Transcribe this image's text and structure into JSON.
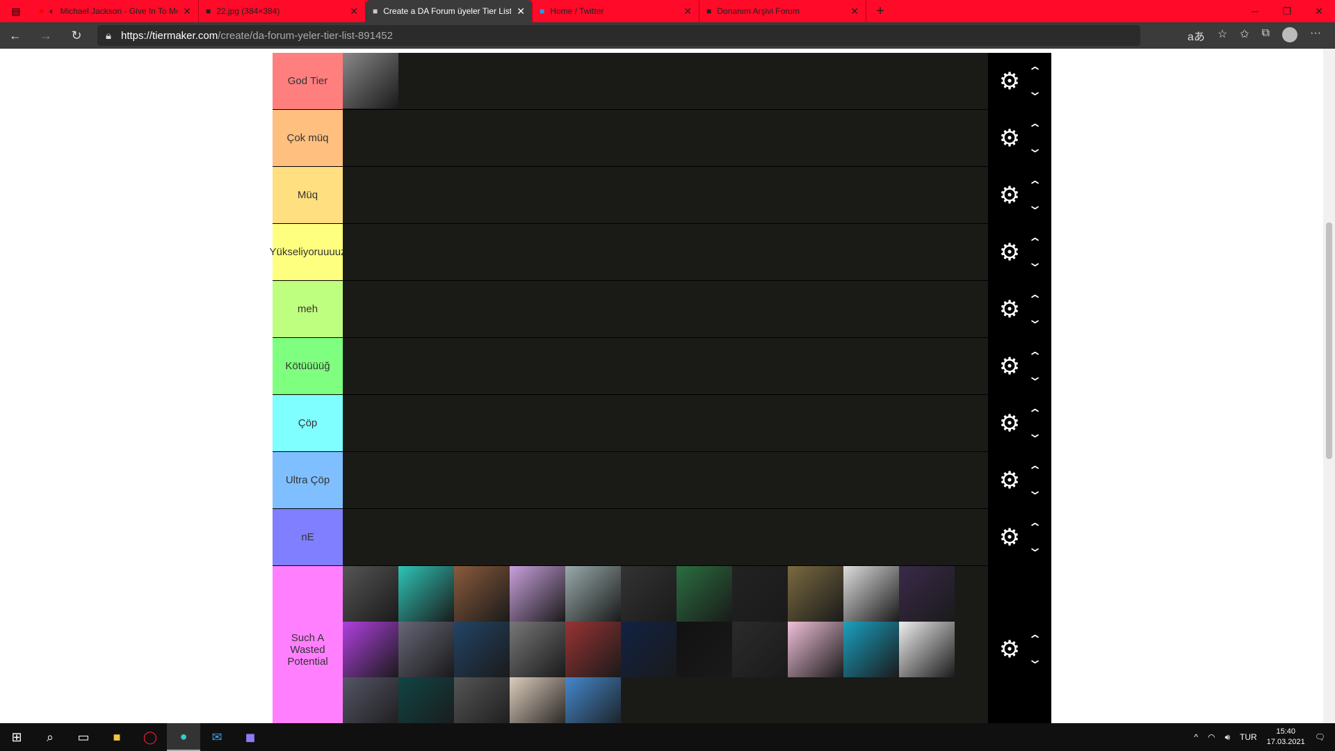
{
  "browser": {
    "tabs": [
      {
        "title": "Michael Jackson - Give In To Me",
        "icon": "youtube-icon",
        "audio": true
      },
      {
        "title": "22.jpg (384×384)",
        "icon": "file-icon"
      },
      {
        "title": "Create a DA Forum üyeler Tier List",
        "icon": "tiermaker-icon",
        "active": true
      },
      {
        "title": "Home / Twitter",
        "icon": "twitter-icon"
      },
      {
        "title": "Donanım Arşivi Forum",
        "icon": "forum-icon"
      }
    ],
    "url_host": "https://tiermaker.com",
    "url_path": "/create/da-forum-yeler-tier-list-891452"
  },
  "tiers": [
    {
      "label": "God Tier",
      "color": "#ff7f7f",
      "items": 1
    },
    {
      "label": "Çok müq",
      "color": "#ffbf7f",
      "items": 0
    },
    {
      "label": "Müq",
      "color": "#ffdf7f",
      "items": 0
    },
    {
      "label": "Yükseliyoruuuuz",
      "color": "#ffff7f",
      "items": 0
    },
    {
      "label": "meh",
      "color": "#bfff7f",
      "items": 0
    },
    {
      "label": "Kötüüüüğ",
      "color": "#7fff7f",
      "items": 0
    },
    {
      "label": "Çöp",
      "color": "#7fffff",
      "items": 0
    },
    {
      "label": "Ultra Çöp",
      "color": "#7fbfff",
      "items": 0
    },
    {
      "label": "nE",
      "color": "#7f7fff",
      "items": 0
    },
    {
      "label": "Such A Wasted Potential",
      "color": "#ff7fff",
      "items": 27
    }
  ],
  "taskbar": {
    "language": "TUR",
    "time": "15:40",
    "date": "17.03.2021"
  }
}
